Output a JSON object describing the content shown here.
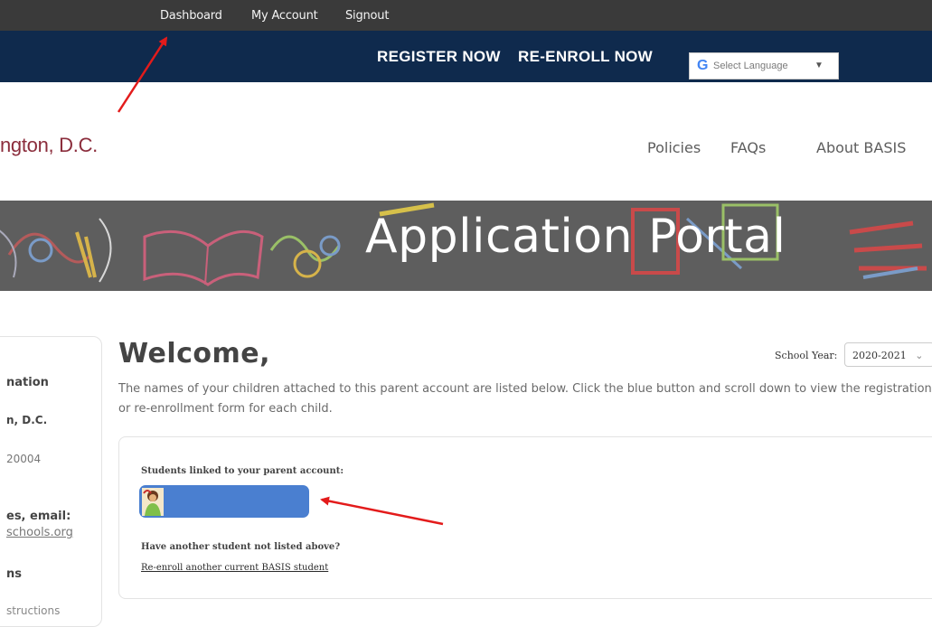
{
  "top_nav": {
    "dashboard": "Dashboard",
    "account": "My Account",
    "signout": "Signout"
  },
  "nav": {
    "register": "REGISTER NOW",
    "reenroll": "RE-ENROLL NOW"
  },
  "language": {
    "g": "G",
    "label": "Select Language",
    "arrow": "▼"
  },
  "header": {
    "logo_text": "ngton, D.C.",
    "links": {
      "policies": "Policies",
      "faqs": "FAQs",
      "about": "About BASIS"
    }
  },
  "banner": {
    "title": "Application Portal"
  },
  "sidebar": {
    "title": "nation",
    "city": "n, D.C.",
    "zip": "20004",
    "email_label": "es, email:",
    "email": "schools.org",
    "section": "ns",
    "instructions": "structions"
  },
  "main": {
    "welcome": "Welcome,",
    "school_year_label": "School Year:",
    "school_year_value": "2020-2021",
    "intro": "The names of your children attached to this parent account are listed below. Click the blue button and scroll down to view the registration or re-enrollment form for each child."
  },
  "students": {
    "title": "Students linked to your parent account:",
    "another_q": "Have another student not listed above?",
    "reenroll_link": "Re-enroll another current BASIS student"
  },
  "colors": {
    "topbar": "#3a3a3a",
    "navbar": "#0f2a4d",
    "brand": "#8b2d3c",
    "button": "#4a7fd0",
    "annotation": "#e31b1b"
  },
  "icons": {
    "student_avatar": "student-avatar-icon",
    "google": "google-icon",
    "dropdown": "chevron-down-icon"
  }
}
